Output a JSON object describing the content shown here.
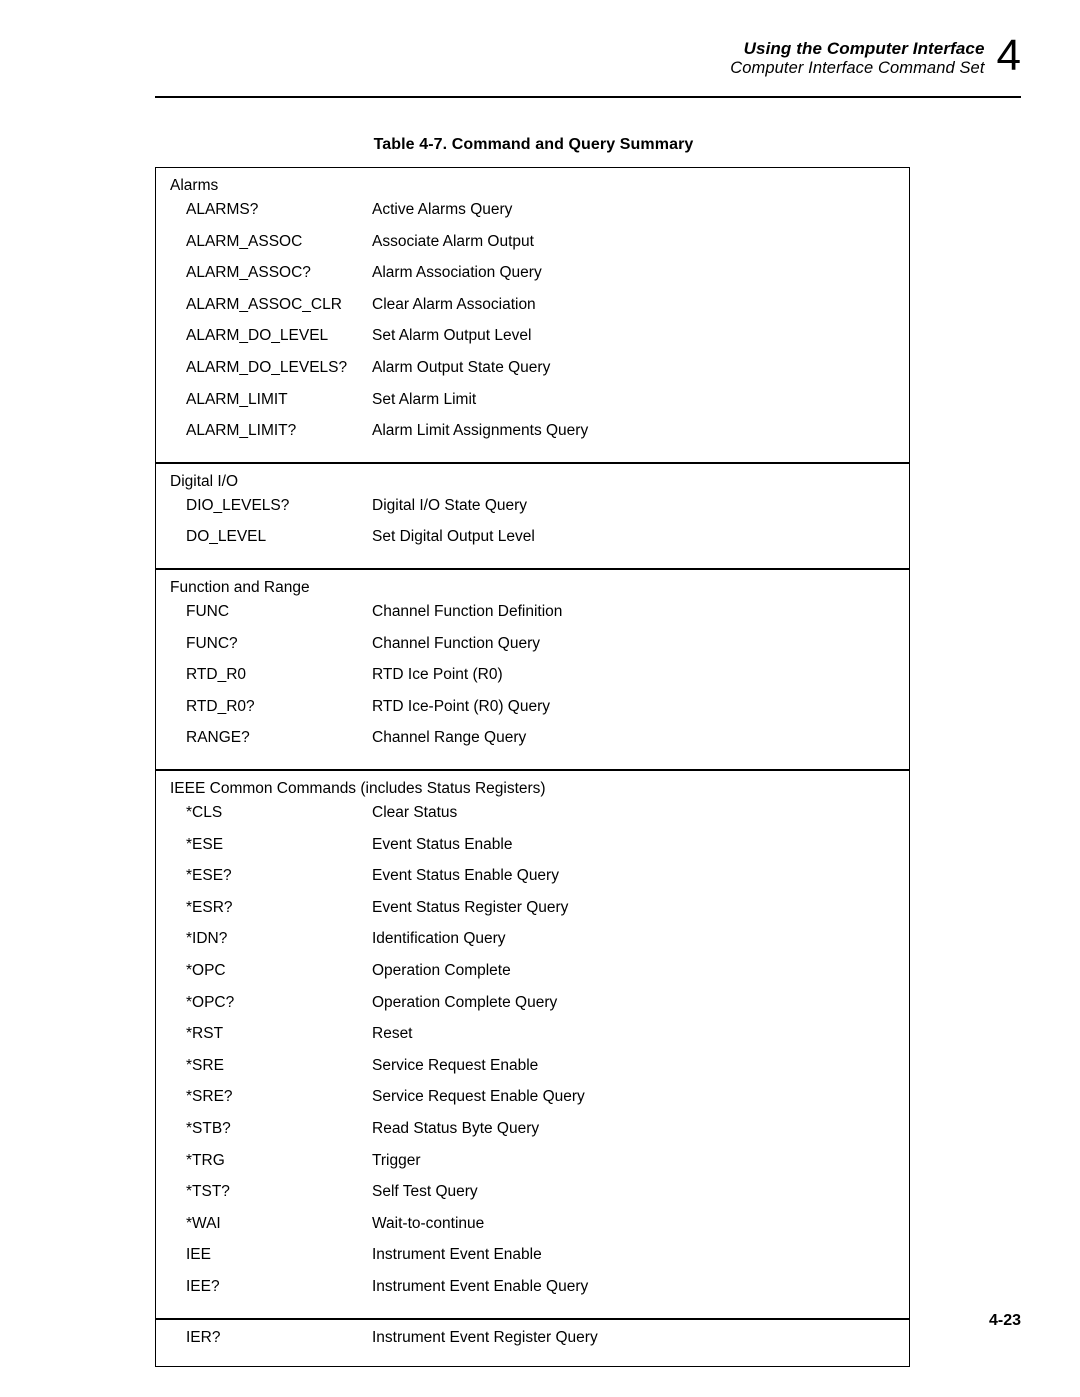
{
  "header": {
    "title": "Using the Computer Interface",
    "subtitle": "Computer Interface Command Set",
    "chapter": "4"
  },
  "table": {
    "caption": "Table 4-7. Command and Query Summary",
    "sections": [
      {
        "heading": "Alarms",
        "rows": [
          {
            "command": "ALARMS?",
            "description": "Active Alarms Query"
          },
          {
            "command": "ALARM_ASSOC",
            "description": "Associate Alarm Output"
          },
          {
            "command": "ALARM_ASSOC?",
            "description": "Alarm Association Query"
          },
          {
            "command": "ALARM_ASSOC_CLR",
            "description": "Clear Alarm Association"
          },
          {
            "command": "ALARM_DO_LEVEL",
            "description": "Set Alarm Output Level"
          },
          {
            "command": "ALARM_DO_LEVELS?",
            "description": "Alarm Output State Query"
          },
          {
            "command": "ALARM_LIMIT",
            "description": "Set Alarm Limit"
          },
          {
            "command": "ALARM_LIMIT?",
            "description": "Alarm Limit Assignments Query"
          }
        ]
      },
      {
        "heading": "Digital I/O",
        "rows": [
          {
            "command": "DIO_LEVELS?",
            "description": "Digital I/O State Query"
          },
          {
            "command": "DO_LEVEL",
            "description": "Set Digital Output Level"
          }
        ]
      },
      {
        "heading": "Function and Range",
        "rows": [
          {
            "command": "FUNC",
            "description": "Channel Function Definition"
          },
          {
            "command": "FUNC?",
            "description": "Channel Function Query"
          },
          {
            "command": "RTD_R0",
            "description": "RTD Ice Point (R0)"
          },
          {
            "command": "RTD_R0?",
            "description": "RTD Ice-Point (R0) Query"
          },
          {
            "command": "RANGE?",
            "description": "Channel Range Query"
          }
        ]
      },
      {
        "heading": "IEEE Common Commands (includes Status Registers)",
        "rows": [
          {
            "command": "*CLS",
            "description": "Clear Status"
          },
          {
            "command": "*ESE",
            "description": "Event Status Enable"
          },
          {
            "command": "*ESE?",
            "description": "Event Status Enable Query"
          },
          {
            "command": "*ESR?",
            "description": "Event Status Register Query"
          },
          {
            "command": "*IDN?",
            "description": "Identification Query"
          },
          {
            "command": "*OPC",
            "description": "Operation Complete"
          },
          {
            "command": "*OPC?",
            "description": "Operation Complete Query"
          },
          {
            "command": "*RST",
            "description": "Reset"
          },
          {
            "command": "*SRE",
            "description": "Service Request Enable"
          },
          {
            "command": "*SRE?",
            "description": "Service Request Enable Query"
          },
          {
            "command": "*STB?",
            "description": "Read Status Byte Query"
          },
          {
            "command": "*TRG",
            "description": "Trigger"
          },
          {
            "command": "*TST?",
            "description": "Self Test Query"
          },
          {
            "command": "*WAI",
            "description": "Wait-to-continue"
          },
          {
            "command": "IEE",
            "description": "Instrument Event Enable"
          },
          {
            "command": "IEE?",
            "description": "Instrument Event Enable Query"
          }
        ]
      },
      {
        "heading": null,
        "rows": [
          {
            "command": "IER?",
            "description": "Instrument Event Register Query"
          }
        ]
      }
    ]
  },
  "footer": {
    "page_number": "4-23"
  }
}
